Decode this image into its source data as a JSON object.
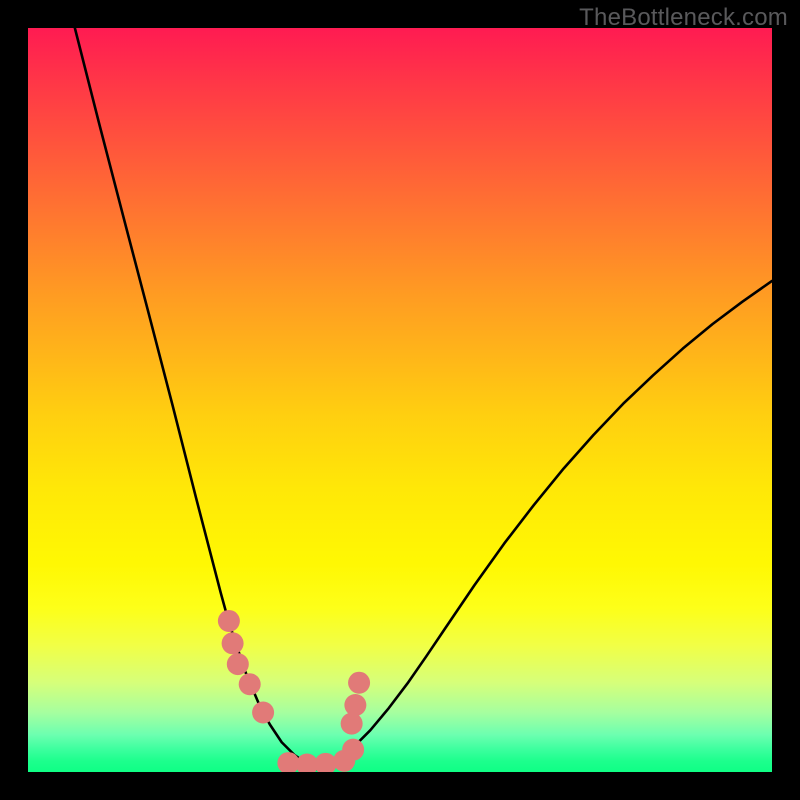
{
  "watermark": "TheBottleneck.com",
  "chart_data": {
    "type": "line",
    "title": "",
    "xlabel": "",
    "ylabel": "",
    "xlim": [
      0,
      100
    ],
    "ylim": [
      0,
      100
    ],
    "grid": false,
    "legend": false,
    "series": [
      {
        "name": "left-curve",
        "x": [
          6.3,
          9.5,
          12.8,
          16.1,
          19.4,
          22.6,
          25.9,
          27.0,
          29.2,
          31.1,
          32.5,
          34.1,
          35.8,
          37.4,
          39.0,
          40.8
        ],
        "values": [
          100,
          87.4,
          74.7,
          62.1,
          49.4,
          36.8,
          24.1,
          20.1,
          13.5,
          9.0,
          6.4,
          4.0,
          2.3,
          1.2,
          0.5,
          0.2
        ]
      },
      {
        "name": "right-curve",
        "x": [
          38.5,
          41.0,
          43.5,
          46.0,
          48.5,
          51.0,
          53.5,
          56.0,
          60.0,
          64.0,
          68.0,
          72.0,
          76.0,
          80.0,
          84.0,
          88.0,
          92.0,
          96.0,
          100.0
        ],
        "values": [
          0.3,
          1.3,
          3.1,
          5.6,
          8.6,
          11.9,
          15.5,
          19.2,
          25.1,
          30.7,
          35.9,
          40.8,
          45.3,
          49.5,
          53.3,
          56.9,
          60.2,
          63.2,
          66.0
        ]
      },
      {
        "name": "pink-markers",
        "x": [
          27.0,
          27.5,
          28.2,
          29.8,
          31.6,
          35.0,
          37.5,
          40.0,
          42.5,
          43.7,
          43.5,
          44.0,
          44.5
        ],
        "values": [
          20.3,
          17.3,
          14.5,
          11.8,
          8.0,
          1.2,
          1.0,
          1.1,
          1.5,
          3.0,
          6.5,
          9.0,
          12.0
        ]
      }
    ],
    "background_gradient": {
      "orientation": "vertical",
      "stops": [
        {
          "pos": 0.0,
          "color": "#ff1b52"
        },
        {
          "pos": 0.08,
          "color": "#ff3946"
        },
        {
          "pos": 0.22,
          "color": "#ff6b34"
        },
        {
          "pos": 0.36,
          "color": "#ff9c22"
        },
        {
          "pos": 0.52,
          "color": "#ffcf10"
        },
        {
          "pos": 0.62,
          "color": "#ffe807"
        },
        {
          "pos": 0.72,
          "color": "#fff803"
        },
        {
          "pos": 0.78,
          "color": "#fdff19"
        },
        {
          "pos": 0.83,
          "color": "#f1ff46"
        },
        {
          "pos": 0.88,
          "color": "#d6ff7a"
        },
        {
          "pos": 0.92,
          "color": "#a6ff9f"
        },
        {
          "pos": 0.95,
          "color": "#6cffb0"
        },
        {
          "pos": 0.97,
          "color": "#3bff9e"
        },
        {
          "pos": 0.985,
          "color": "#1dff8d"
        },
        {
          "pos": 1.0,
          "color": "#0fff85"
        }
      ]
    },
    "marker_color": "#e17a78",
    "line_color": "#000000"
  }
}
